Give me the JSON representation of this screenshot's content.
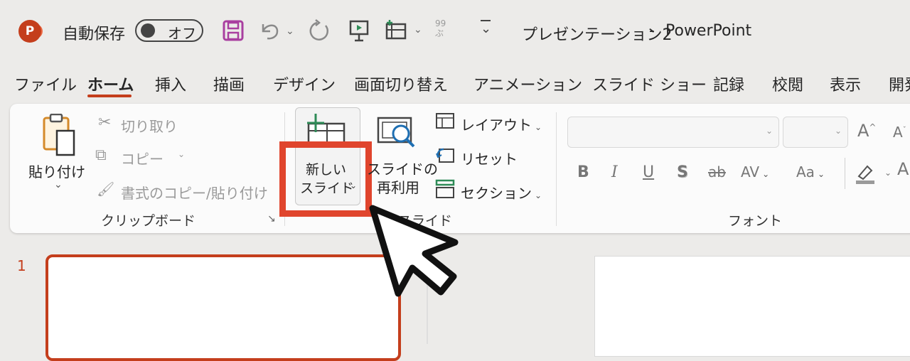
{
  "titlebar": {
    "app_icon_letter": "P",
    "autosave_label": "自動保存",
    "autosave_state": "オフ",
    "doc_title": "プレゼンテーション2",
    "separator": "-",
    "app_name": "PowerPoint",
    "icons": [
      "save-icon",
      "undo-icon",
      "redo-icon",
      "present-icon",
      "layout-icon",
      "pinyin-icon",
      "customize-icon"
    ]
  },
  "tabs": [
    {
      "label": "ファイル"
    },
    {
      "label": "ホーム",
      "active": true
    },
    {
      "label": "挿入"
    },
    {
      "label": "描画"
    },
    {
      "label": "デザイン"
    },
    {
      "label": "画面切り替え"
    },
    {
      "label": "アニメーション"
    },
    {
      "label": "スライド ショー"
    },
    {
      "label": "記録"
    },
    {
      "label": "校閲"
    },
    {
      "label": "表示"
    },
    {
      "label": "開発"
    }
  ],
  "clipboard": {
    "paste_line1": "貼り付け",
    "cut": "切り取り",
    "copy": "コピー",
    "format_painter": "書式のコピー/貼り付け",
    "group_label": "クリップボード"
  },
  "slides": {
    "new_slide_line1": "新しい",
    "new_slide_line2": "スライド",
    "reuse_line1": "スライドの",
    "reuse_line2": "再利用",
    "layout": "レイアウト",
    "reset": "リセット",
    "section": "セクション",
    "group_label": "スライド"
  },
  "font": {
    "bold": "B",
    "italic": "I",
    "underline": "U",
    "shadow": "S",
    "strike": "ab",
    "spacing": "AV",
    "case": "Aa",
    "grow": "A",
    "shrink": "A",
    "group_label": "フォント"
  },
  "panel": {
    "slide_number": "1"
  },
  "colors": {
    "accent": "#c43e1c",
    "highlight": "#e0452d",
    "save_icon": "#a93fa0"
  }
}
